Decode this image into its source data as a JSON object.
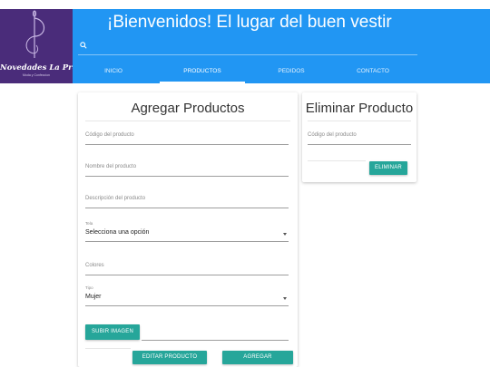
{
  "brand": {
    "name": "Novedades La Presa",
    "tagline": "Moda y Confeccion",
    "colors": {
      "logo_bg": "#4a2c7a",
      "header_bg": "#2196f3",
      "button": "#26a69a"
    }
  },
  "header": {
    "title": "¡Bienvenidos! El lugar del buen vestir",
    "search": {
      "icon": "search-icon",
      "placeholder": ""
    }
  },
  "nav": {
    "tabs": [
      {
        "label": "INICIO",
        "active": false
      },
      {
        "label": "PRODUCTOS",
        "active": true
      },
      {
        "label": "PEDIDOS",
        "active": false
      },
      {
        "label": "CONTACTO",
        "active": false
      }
    ]
  },
  "add_card": {
    "title": "Agregar Productos",
    "fields": {
      "codigo": {
        "placeholder": "Código del producto"
      },
      "nombre": {
        "placeholder": "Nombre del producto"
      },
      "descripcion": {
        "placeholder": "Descripción del producto"
      },
      "tela": {
        "label": "Tela",
        "value": "Selecciona una opción"
      },
      "colores": {
        "placeholder": "Colores"
      },
      "tipo": {
        "label": "Tipo",
        "value": "Mujer"
      }
    },
    "upload_button": "SUBIR IMAGEN",
    "edit_button": "EDITAR PRODUCTO",
    "add_button": "AGREGAR"
  },
  "delete_card": {
    "title": "Eliminar Producto",
    "code_placeholder": "Código del producto",
    "delete_button": "ELIMINAR"
  }
}
